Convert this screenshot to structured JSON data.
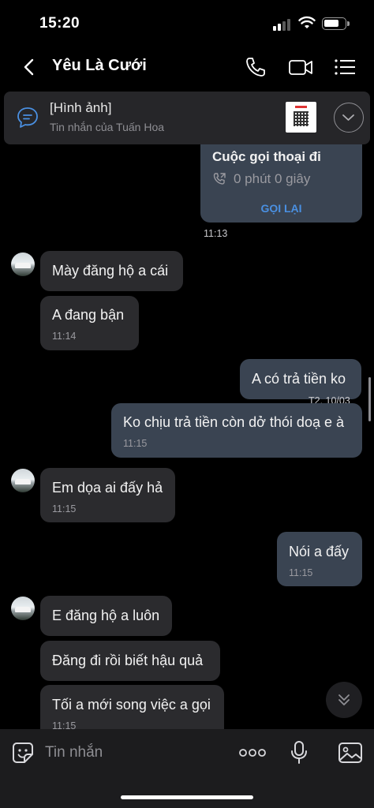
{
  "status_bar": {
    "time": "15:20"
  },
  "header": {
    "title": "Yêu Là Cưới"
  },
  "pinned": {
    "title": "[Hình ảnh]",
    "subtitle": "Tin nhắn của Tuấn Hoa"
  },
  "call_card": {
    "title": "Cuộc gọi thoại đi",
    "duration": "0 phút 0 giây",
    "action": "GỌI LẠI",
    "time": "11:13"
  },
  "messages": [
    {
      "dir": "in",
      "text": "Mày đăng hộ a cái"
    },
    {
      "dir": "in",
      "text": "A đang bận",
      "time": "11:14"
    },
    {
      "dir": "out",
      "text": "A có trả tiền ko",
      "time": "T2, 10/03"
    },
    {
      "dir": "out",
      "text": "Ko chịu trả tiền còn dở thói doạ e à",
      "time": "11:15"
    },
    {
      "dir": "in",
      "text": "Em dọa ai đấy hả",
      "time": "11:15"
    },
    {
      "dir": "out",
      "text": "Nói a đấy",
      "time": "11:15"
    },
    {
      "dir": "in",
      "text": "E đăng hộ a luôn"
    },
    {
      "dir": "in",
      "text": "Đăng đi rồi biết hậu quả"
    },
    {
      "dir": "in",
      "text": "Tối a mới song việc a gọi",
      "time": "11:15"
    }
  ],
  "input": {
    "placeholder": "Tin nhắn"
  },
  "colors": {
    "background": "#000000",
    "incoming_bubble": "#2b2b2e",
    "outgoing_bubble": "#3a4452",
    "accent": "#4a90e2"
  },
  "icons": [
    "back-arrow-icon",
    "phone-icon",
    "video-call-icon",
    "menu-list-icon",
    "chat-bubble-icon",
    "chevron-down-icon",
    "sticker-icon",
    "more-dots-icon",
    "microphone-icon",
    "image-icon"
  ]
}
